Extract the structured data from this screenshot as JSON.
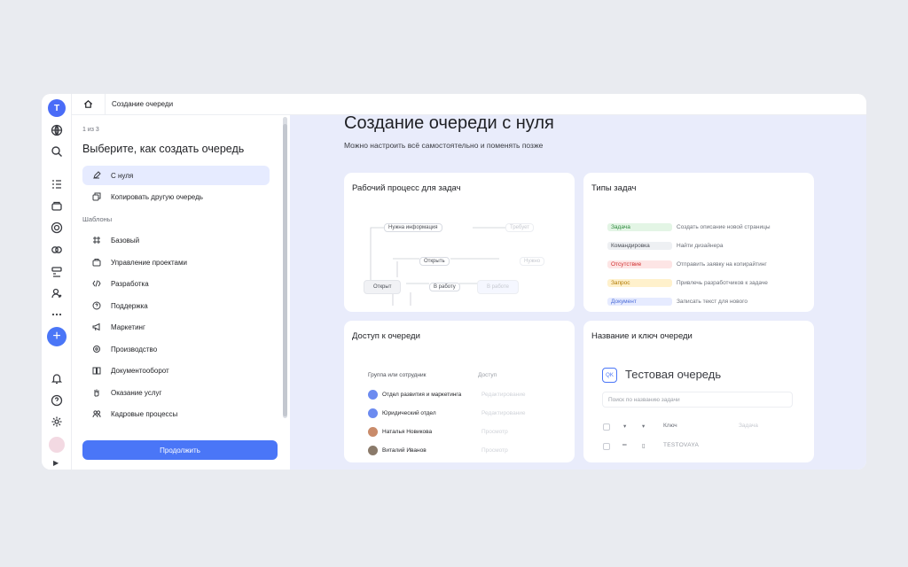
{
  "breadcrumb": {
    "title": "Создание очереди"
  },
  "rail": {
    "logo": "T",
    "icons": [
      "globe-icon",
      "search-icon",
      "list-icon",
      "folder-icon",
      "target-icon",
      "components-icon",
      "board-icon",
      "person-icon",
      "more-icon"
    ],
    "bottom_icons": [
      "bell-icon",
      "help-icon",
      "settings-icon"
    ]
  },
  "wizard": {
    "step": "1 из 3",
    "title": "Выберите, как создать очередь",
    "options": [
      {
        "label": "С нуля",
        "icon": "pencil-icon"
      },
      {
        "label": "Копировать другую очередь",
        "icon": "copy-icon"
      }
    ],
    "section": "Шаблоны",
    "templates": [
      {
        "label": "Базовый",
        "icon": "frame-icon"
      },
      {
        "label": "Управление проектами",
        "icon": "projects-icon"
      },
      {
        "label": "Разработка",
        "icon": "code-icon"
      },
      {
        "label": "Поддержка",
        "icon": "support-icon"
      },
      {
        "label": "Маркетинг",
        "icon": "megaphone-icon"
      },
      {
        "label": "Производство",
        "icon": "factory-icon"
      },
      {
        "label": "Документооборот",
        "icon": "book-icon"
      },
      {
        "label": "Оказание услуг",
        "icon": "hand-icon"
      },
      {
        "label": "Кадровые процессы",
        "icon": "people-icon"
      }
    ],
    "continue": "Продолжить"
  },
  "main": {
    "title": "Создание очереди с нуля",
    "subtitle": "Можно настроить всё самостоятельно и поменять позже"
  },
  "cards": {
    "workflow": {
      "title": "Рабочий процесс для задач",
      "chips": {
        "need_info": "Нужна информация",
        "open_link": "Открыть",
        "open_state": "Открыт",
        "to_work": "В работу",
        "in_work": "В работе",
        "faded_1": "Требует",
        "faded_2": "Нужно"
      }
    },
    "types": {
      "title": "Типы задач",
      "rows": [
        {
          "tag": "Задача",
          "desc": "Создать описание новой страницы",
          "bg": "#e3f5e5",
          "fg": "#2f8a3e"
        },
        {
          "tag": "Командировка",
          "desc": "Найти дизайнера",
          "bg": "#eef0f3",
          "fg": "#4a4d55"
        },
        {
          "tag": "Отсутствие",
          "desc": "Отправить заявку на копирайтинг",
          "bg": "#fde5e5",
          "fg": "#d12f2f"
        },
        {
          "tag": "Запрос",
          "desc": "Привлечь разработчиков к задаче",
          "bg": "#fff1cc",
          "fg": "#b07800"
        },
        {
          "tag": "Документ",
          "desc": "Записать текст для нового",
          "bg": "#e6ebff",
          "fg": "#4a6cd8"
        }
      ]
    },
    "access": {
      "title": "Доступ к очереди",
      "col_group": "Группа или сотрудник",
      "col_access": "Доступ",
      "members": [
        {
          "name": "Отдел развития и маркетинга",
          "access": "Редактирование"
        },
        {
          "name": "Юридический отдел",
          "access": "Редактирование"
        },
        {
          "name": "Наталья Новикова",
          "access": "Просмотр"
        },
        {
          "name": "Виталий Иванов",
          "access": "Просмотр"
        }
      ]
    },
    "queue_key": {
      "title": "Название и ключ очереди",
      "badge": "QK",
      "queue_name": "Тестовая очередь",
      "search_placeholder": "Поиск по названию задачи",
      "col_key": "Ключ",
      "col_task": "Задача",
      "key_value": "TESTOVAYA"
    }
  }
}
